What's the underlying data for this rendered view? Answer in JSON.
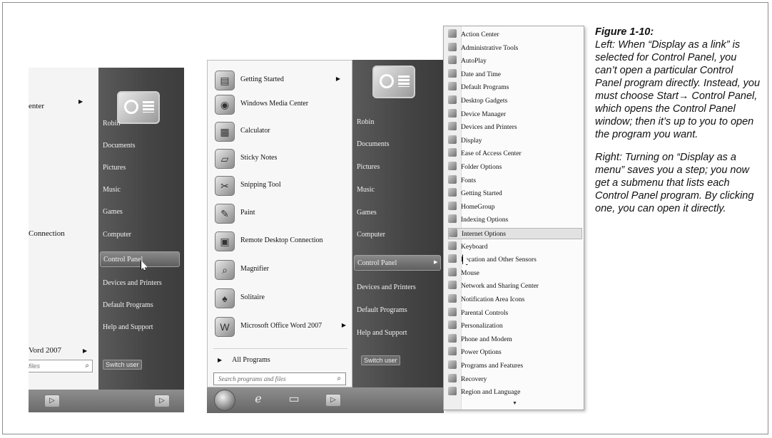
{
  "caption": {
    "figure_label": "Figure 1-10:",
    "para1": "Left: When “Display as a link” is selected for Control Panel, you can’t open a particular Control Panel program directly. Instead, you must choose Start→ Control Panel, which opens the Control Panel window; then it’s up to you to open the program you want.",
    "para2": "Right: Turning on “Display as a menu” saves you a step; you now get a submenu that lists each Control Panel program. By clicking one, you can open it directly."
  },
  "left_menu": {
    "cropped_items": [
      "enter",
      "Connection",
      "Vord 2007"
    ],
    "search_placeholder": "files",
    "side_items": [
      "Robin",
      "Documents",
      "Pictures",
      "Music",
      "Games",
      "Computer",
      "Control Panel",
      "Devices and Printers",
      "Default Programs",
      "Help and Support"
    ],
    "highlighted": "Control Panel",
    "switch_user": "Switch user"
  },
  "middle_menu": {
    "programs": [
      {
        "label": "Getting Started",
        "icon": "getting-started-icon",
        "glyph": "▤",
        "has_arrow": true
      },
      {
        "label": "Windows Media Center",
        "icon": "media-center-icon",
        "glyph": "◉",
        "has_arrow": false
      },
      {
        "label": "Calculator",
        "icon": "calculator-icon",
        "glyph": "▦",
        "has_arrow": false
      },
      {
        "label": "Sticky Notes",
        "icon": "sticky-notes-icon",
        "glyph": "▱",
        "has_arrow": false
      },
      {
        "label": "Snipping Tool",
        "icon": "scissors-icon",
        "glyph": "✂",
        "has_arrow": false
      },
      {
        "label": "Paint",
        "icon": "paint-icon",
        "glyph": "✎",
        "has_arrow": false
      },
      {
        "label": "Remote Desktop Connection",
        "icon": "remote-desktop-icon",
        "glyph": "▣",
        "has_arrow": false
      },
      {
        "label": "Magnifier",
        "icon": "magnifier-icon",
        "glyph": "⌕",
        "has_arrow": false
      },
      {
        "label": "Solitaire",
        "icon": "solitaire-icon",
        "glyph": "♠",
        "has_arrow": false
      },
      {
        "label": "Microsoft Office Word 2007",
        "icon": "word-icon",
        "glyph": "W",
        "has_arrow": true
      }
    ],
    "all_programs": "All Programs",
    "search_placeholder": "Search programs and files",
    "side_items": [
      "Robin",
      "Documents",
      "Pictures",
      "Music",
      "Games",
      "Computer",
      "Control Panel",
      "Devices and Printers",
      "Default Programs",
      "Help and Support"
    ],
    "highlighted": "Control Panel",
    "switch_user": "Switch user"
  },
  "control_panel_menu": {
    "items": [
      "Action Center",
      "Administrative Tools",
      "AutoPlay",
      "Date and Time",
      "Default Programs",
      "Desktop Gadgets",
      "Device Manager",
      "Devices and Printers",
      "Display",
      "Ease of Access Center",
      "Folder Options",
      "Fonts",
      "Getting Started",
      "HomeGroup",
      "Indexing Options",
      "Internet Options",
      "Keyboard",
      "Location and Other Sensors",
      "Mouse",
      "Network and Sharing Center",
      "Notification Area Icons",
      "Parental Controls",
      "Personalization",
      "Phone and Modem",
      "Power Options",
      "Programs and Features",
      "Recovery",
      "Region and Language"
    ],
    "highlighted": "Internet Options"
  }
}
